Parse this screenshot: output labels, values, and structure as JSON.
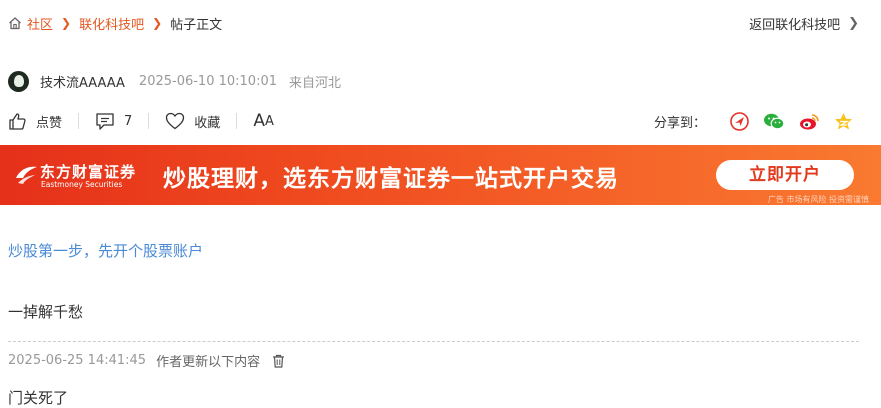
{
  "breadcrumb": {
    "home": "社区",
    "forum": "联化科技吧",
    "current": "帖子正文",
    "back_link": "返回联化科技吧"
  },
  "author": {
    "name": "技术流AAAAA",
    "posted_at": "2025-06-10 10:10:01",
    "location": "来自河北"
  },
  "actions": {
    "like_label": "点赞",
    "comment_count": "7",
    "favorite_label": "收藏",
    "font_size_big": "A",
    "font_size_small": "A",
    "share_label": "分享到："
  },
  "banner": {
    "brand": "东方财富证券",
    "brand_en": "Eastmoney Securities",
    "slogan": "炒股理财，选东方财富证券一站式开户交易",
    "cta": "立即开户",
    "disclaimer": "广告 市场有风险 投资需谨慎"
  },
  "content": {
    "promo_link": "炒股第一步，先开个股票账户",
    "paragraph": "一掉解千愁",
    "update_date": "2025-06-25 14:41:45",
    "update_note": "作者更新以下内容",
    "update_text": "门关死了"
  },
  "colors": {
    "accent": "#e4571f",
    "link": "#4b8ad6",
    "banner_start": "#e5301a",
    "banner_end": "#f97a30"
  }
}
